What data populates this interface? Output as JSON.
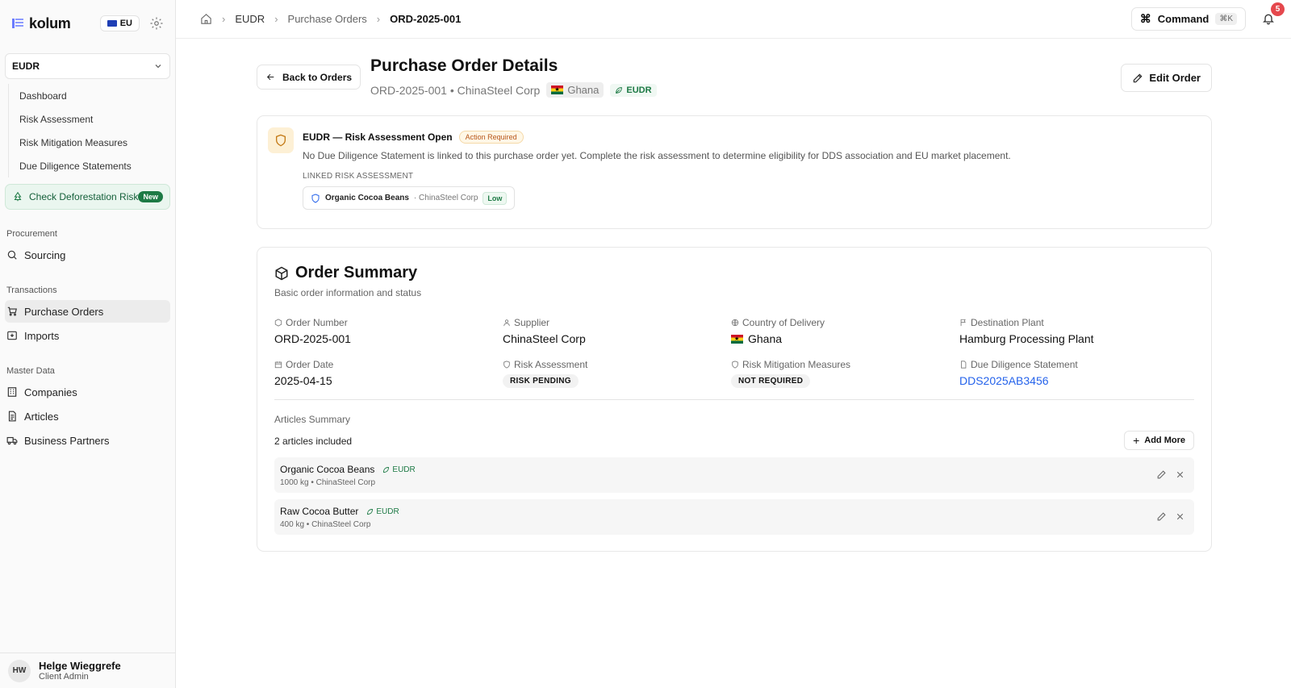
{
  "sidebar": {
    "brand": "kolum",
    "region": "EU",
    "module": "EUDR",
    "module_items": [
      {
        "label": "Dashboard"
      },
      {
        "label": "Risk Assessment"
      },
      {
        "label": "Risk Mitigation Measures"
      },
      {
        "label": "Due Diligence Statements"
      }
    ],
    "check_risk": {
      "label": "Check Deforestation Risk",
      "badge": "New"
    },
    "sections": {
      "procurement": "Procurement",
      "transactions": "Transactions",
      "master_data": "Master Data"
    },
    "items": {
      "sourcing": "Sourcing",
      "purchase_orders": "Purchase Orders",
      "imports": "Imports",
      "companies": "Companies",
      "articles": "Articles",
      "business_partners": "Business Partners"
    },
    "user": {
      "initials": "HW",
      "name": "Helge Wieggrefe",
      "role": "Client Admin"
    }
  },
  "topbar": {
    "breadcrumb": [
      "EUDR",
      "Purchase Orders",
      "ORD-2025-001"
    ],
    "command_label": "Command",
    "command_shortcut": "⌘K",
    "notification_count": "5"
  },
  "header": {
    "back_label": "Back to Orders",
    "title": "Purchase Order Details",
    "subtitle": "ORD-2025-001 • ChinaSteel Corp",
    "country_tag": "Ghana",
    "regulation_tag": "EUDR",
    "edit_label": "Edit Order"
  },
  "alert": {
    "title": "EUDR — Risk Assessment Open",
    "badge": "Action Required",
    "text": "No Due Diligence Statement is linked to this purchase order yet. Complete the risk assessment to determine eligibility for DDS association and EU market placement.",
    "linked_label": "LINKED RISK ASSESSMENT",
    "linked_product": "Organic Cocoa Beans",
    "linked_supplier": "· ChinaSteel Corp",
    "linked_level": "Low"
  },
  "summary": {
    "title": "Order Summary",
    "subtitle": "Basic order information and status",
    "fields": {
      "order_number": {
        "label": "Order Number",
        "value": "ORD-2025-001"
      },
      "supplier": {
        "label": "Supplier",
        "value": "ChinaSteel Corp"
      },
      "country": {
        "label": "Country of Delivery",
        "value": "Ghana"
      },
      "plant": {
        "label": "Destination Plant",
        "value": "Hamburg Processing Plant"
      },
      "order_date": {
        "label": "Order Date",
        "value": "2025-04-15"
      },
      "risk_assessment": {
        "label": "Risk Assessment",
        "value": "RISK PENDING"
      },
      "risk_mitigation": {
        "label": "Risk Mitigation Measures",
        "value": "NOT REQUIRED"
      },
      "dds": {
        "label": "Due Diligence Statement",
        "value": "DDS2025AB3456"
      }
    },
    "articles_label": "Articles Summary",
    "articles_count": "2 articles included",
    "add_more": "Add More",
    "articles": [
      {
        "name": "Organic Cocoa Beans",
        "tag": "EUDR",
        "meta": "1000 kg • ChinaSteel Corp"
      },
      {
        "name": "Raw Cocoa Butter",
        "tag": "EUDR",
        "meta": "400 kg • ChinaSteel Corp"
      }
    ]
  },
  "colors": {
    "accent_green": "#1d7a45",
    "link_blue": "#2563eb",
    "warning_bg": "#fdf0d5",
    "badge_red": "#e5484d"
  }
}
